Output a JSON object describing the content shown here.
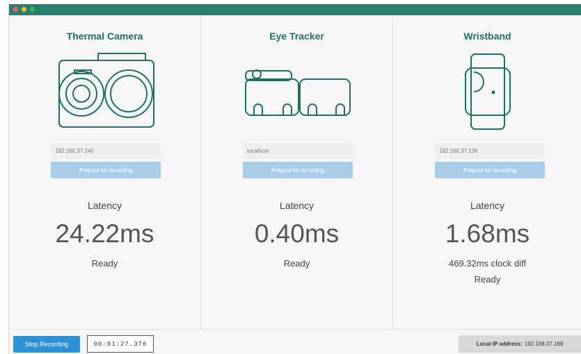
{
  "window": {
    "accent_color": "#2b7d6d"
  },
  "devices": [
    {
      "title": "Thermal Camera",
      "icon": "thermal-camera-icon",
      "ip": "192.168.37.245",
      "prepare_label": "Prepare for recording",
      "latency_label": "Latency",
      "latency": "24.22ms",
      "status": "Ready"
    },
    {
      "title": "Eye Tracker",
      "icon": "eye-tracker-icon",
      "ip": "localhost",
      "prepare_label": "Prepare for recording",
      "latency_label": "Latency",
      "latency": "0.40ms",
      "status": "Ready"
    },
    {
      "title": "Wristband",
      "icon": "wristband-icon",
      "ip": "192.168.37.136",
      "prepare_label": "Prepare for recording",
      "latency_label": "Latency",
      "latency": "1.68ms",
      "clock_diff": "469.32ms clock diff",
      "status": "Ready"
    }
  ],
  "footer": {
    "stop_label": "Stop Recording",
    "timer": "00:01:27.376",
    "ip_label": "Local IP address:",
    "ip_value": "192.168.37.169"
  },
  "colors": {
    "title": "#1f6f62",
    "button": "#a9cde8",
    "stop": "#2e93d6"
  }
}
